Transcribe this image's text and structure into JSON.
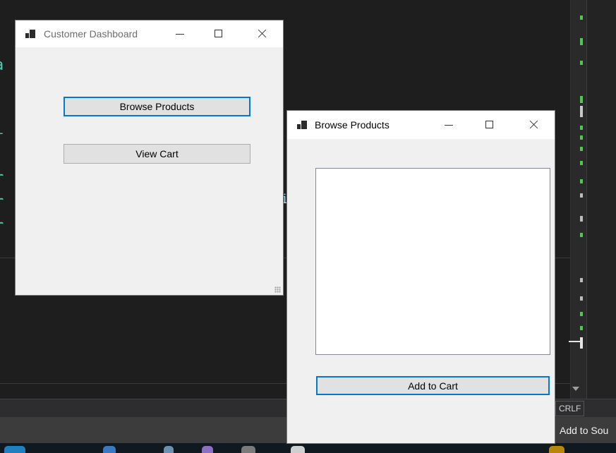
{
  "customer_dashboard": {
    "title": "Customer Dashboard",
    "buttons": [
      "Browse Products",
      "View Cart"
    ]
  },
  "browse_products": {
    "title": "Browse Products",
    "listbox_items": [],
    "add_button": "Add to Cart"
  },
  "ide": {
    "line_ending": "CRLF",
    "status_text": "Add to Sou"
  },
  "colors": {
    "ide_background": "#1e1e1e",
    "status_bar": "#3c3c3c",
    "focus_border": "#0078d7",
    "form_background": "#f0f0f0",
    "scroll_marker_green": "#4ec94e"
  },
  "icons": [
    "app-icon",
    "minimize-icon",
    "maximize-icon",
    "close-icon",
    "resize-grip-icon",
    "scroll-down-arrow-icon"
  ]
}
